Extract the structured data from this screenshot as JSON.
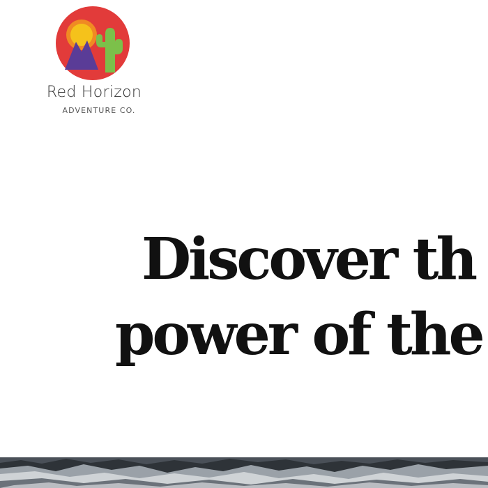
{
  "logo": {
    "name": "Red Horizon",
    "tagline": "ADVENTURE CO.",
    "colors": {
      "circle": "#e23b3a",
      "sun": "#f5c21b",
      "sun_ring": "#f08a23",
      "mountain": "#5a3c97",
      "cactus": "#7cc04a"
    }
  },
  "hero": {
    "heading_line_1": "Discover th",
    "heading_line_2": "power of the"
  },
  "banner": {
    "icon": "mountain-photo"
  }
}
